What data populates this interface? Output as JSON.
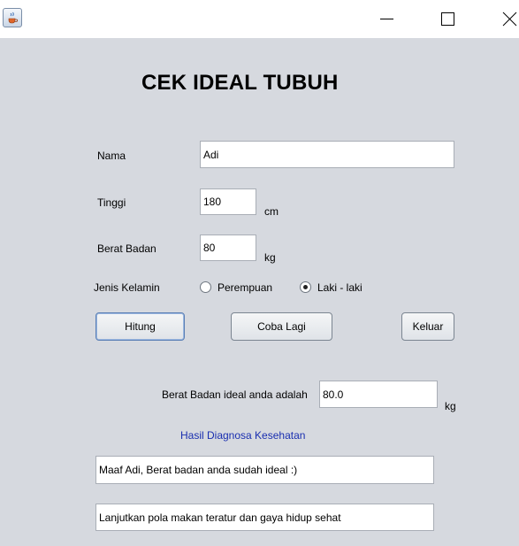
{
  "window": {
    "icon": "java-cup-icon"
  },
  "form": {
    "heading": "CEK IDEAL TUBUH",
    "name_label": "Nama",
    "name_value": "Adi",
    "height_label": "Tinggi",
    "height_value": "180",
    "height_unit": "cm",
    "weight_label": "Berat Badan",
    "weight_value": "80",
    "weight_unit": "kg",
    "gender_label": "Jenis Kelamin",
    "gender_options": [
      {
        "label": "Perempuan",
        "selected": false
      },
      {
        "label": "Laki - laki",
        "selected": true
      }
    ]
  },
  "buttons": {
    "calculate": "Hitung",
    "retry": "Coba Lagi",
    "exit": "Keluar"
  },
  "result": {
    "ideal_label": "Berat Badan ideal anda adalah",
    "ideal_value": "80.0",
    "ideal_unit": "kg",
    "diagnosis_title": "Hasil Diagnosa Kesehatan",
    "diagnosis_line1": "Maaf Adi, Berat badan anda sudah ideal :)",
    "diagnosis_line2": "Lanjutkan pola makan teratur dan gaya hidup sehat"
  },
  "colors": {
    "background": "#d6d9df",
    "diagnosis_title": "#1a2fb0"
  }
}
